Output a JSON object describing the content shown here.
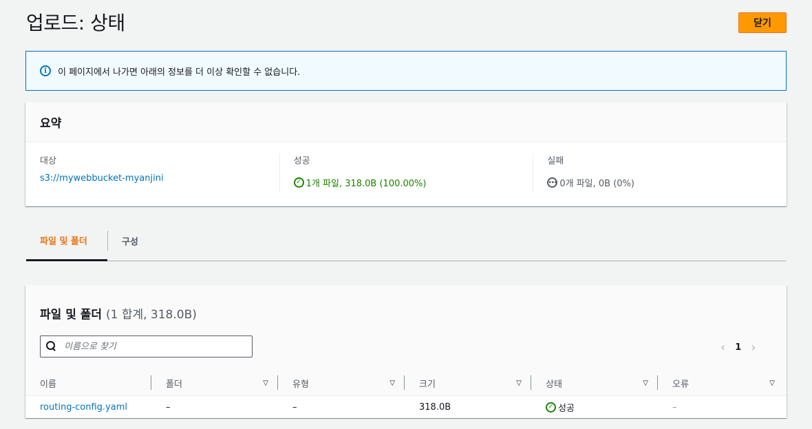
{
  "header": {
    "title": "업로드: 상태",
    "close_label": "닫기"
  },
  "banner": {
    "text": "이 페이지에서 나가면 아래의 정보를 더 이상 확인할 수 없습니다.",
    "icon": "info-icon"
  },
  "summary": {
    "title": "요약",
    "target_label": "대상",
    "target_value": "s3://mywebbucket-myanjini",
    "success_label": "성공",
    "success_value": "1개 파일, 318.0B (100.00%)",
    "failure_label": "실패",
    "failure_value": "0개 파일, 0B (0%)"
  },
  "tabs": [
    {
      "label": "파일 및 폴더",
      "active": true
    },
    {
      "label": "구성",
      "active": false
    }
  ],
  "files": {
    "title": "파일 및 폴더",
    "count": "(1 합계, 318.0B)",
    "search_placeholder": "이름으로 찾기",
    "page": "1",
    "columns": [
      "이름",
      "폴더",
      "유형",
      "크기",
      "상태",
      "오류"
    ],
    "rows": [
      {
        "name": "routing-config.yaml",
        "folder": "–",
        "type": "–",
        "size": "318.0B",
        "status": "성공",
        "error": "–"
      }
    ]
  },
  "colors": {
    "accent": "#ff9900",
    "link": "#0073bb",
    "success": "#1d8102",
    "active_tab": "#ec7211"
  }
}
